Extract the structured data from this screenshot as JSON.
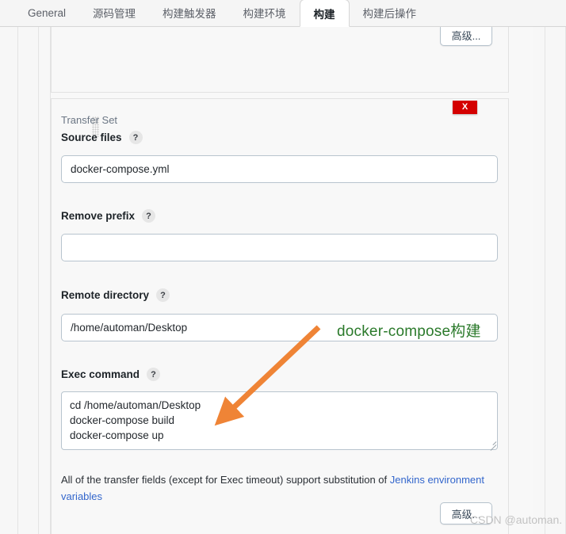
{
  "tabs": [
    {
      "label": "General",
      "active": false
    },
    {
      "label": "源码管理",
      "active": false
    },
    {
      "label": "构建触发器",
      "active": false
    },
    {
      "label": "构建环境",
      "active": false
    },
    {
      "label": "构建",
      "active": true
    },
    {
      "label": "构建后操作",
      "active": false
    }
  ],
  "buttons": {
    "advanced_top": "高级...",
    "advanced_bottom": "高级...",
    "delete_transfer_set": "X"
  },
  "transfer_set": {
    "title": "Transfer Set",
    "help_glyph": "?",
    "fields": [
      {
        "label": "Source files",
        "value": "docker-compose.yml",
        "placeholder": ""
      },
      {
        "label": "Remove prefix",
        "value": "",
        "placeholder": ""
      },
      {
        "label": "Remote directory",
        "value": "/home/automan/Desktop",
        "placeholder": ""
      },
      {
        "label": "Exec command",
        "value": "cd /home/automan/Desktop\ndocker-compose build\ndocker-compose up",
        "placeholder": ""
      }
    ],
    "note": {
      "text_before": "All of the transfer fields (except for Exec timeout) support substitution of ",
      "link_text": "Jenkins environment variables"
    }
  },
  "annotations": {
    "green_label": "docker-compose构建",
    "green_color": "#2b7a2b",
    "arrow_color": "#ef8436",
    "watermark": "CSDN @automan."
  }
}
